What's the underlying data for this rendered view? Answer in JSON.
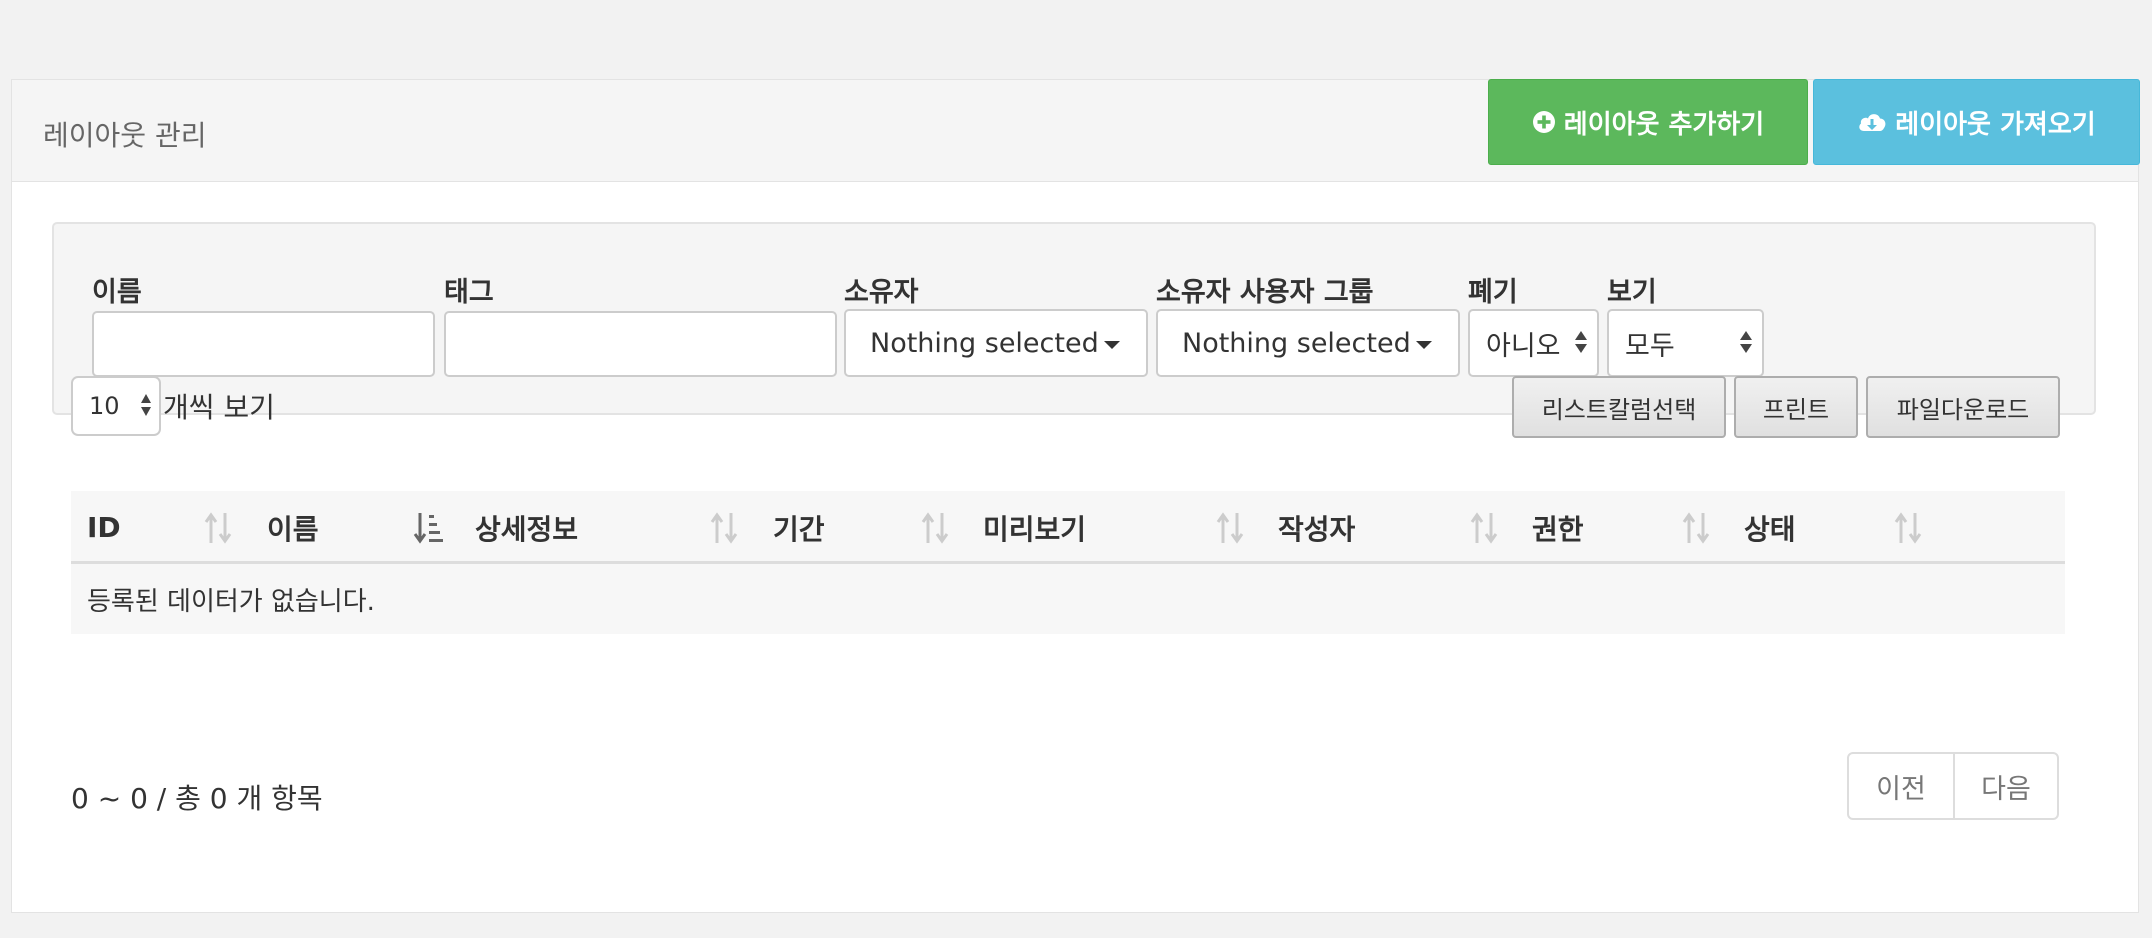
{
  "header": {
    "title": "레이아웃 관리",
    "add_button": "레이아웃 추가하기",
    "import_button": "레이아웃 가져오기"
  },
  "filters": {
    "name_label": "이름",
    "tag_label": "태그",
    "owner_label": "소유자",
    "owner_value": "Nothing selected",
    "owner_group_label": "소유자 사용자 그룹",
    "owner_group_value": "Nothing selected",
    "discard_label": "폐기",
    "discard_value": "아니오",
    "view_label": "보기",
    "view_value": "모두"
  },
  "table_controls": {
    "page_size": "10",
    "page_size_suffix": "개씩 보기",
    "column_select_button": "리스트칼럼선택",
    "print_button": "프린트",
    "download_button": "파일다운로드"
  },
  "table": {
    "columns": [
      "ID",
      "이름",
      "상세정보",
      "기간",
      "미리보기",
      "작성자",
      "권한",
      "상태"
    ],
    "empty_message": "등록된 데이터가 없습니다."
  },
  "footer": {
    "summary": "0 ~ 0 / 총 0 개 항목",
    "prev": "이전",
    "next": "다음"
  },
  "colors": {
    "success": "#5cb85c",
    "info": "#5bc0de"
  }
}
